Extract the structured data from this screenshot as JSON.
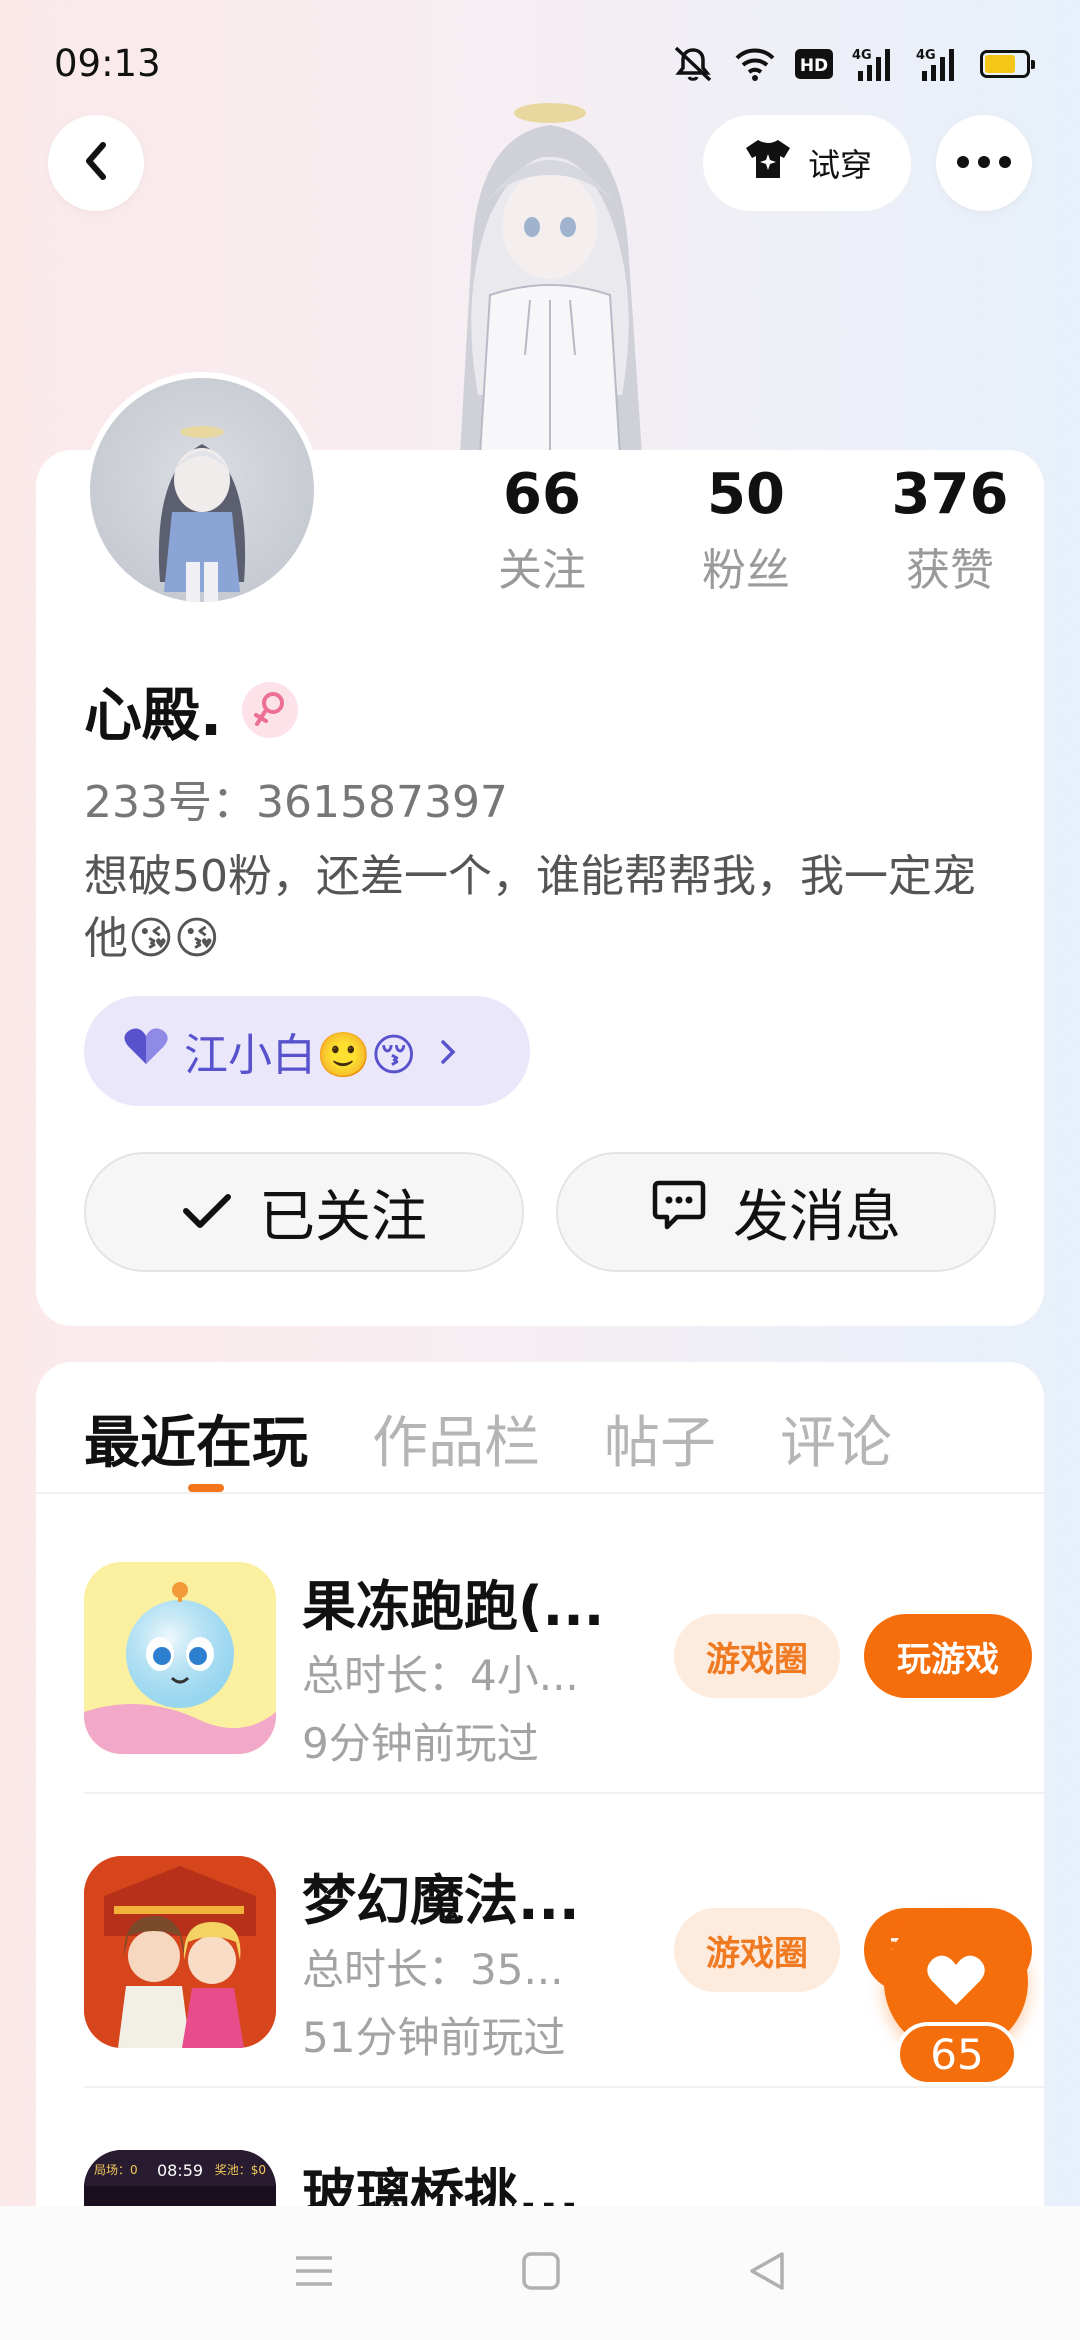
{
  "status_bar": {
    "time": "09:13",
    "network_labels": [
      "4G",
      "4G"
    ],
    "hd_label": "HD",
    "battery_percent": 0.75,
    "battery_color": "#f5c518"
  },
  "header": {
    "back_icon": "chevron-left-icon",
    "tryon_label": "试穿",
    "tryon_icon": "shirt-sparkle-icon",
    "more_icon": "ellipsis-icon"
  },
  "profile": {
    "stats": [
      {
        "value": "66",
        "label": "关注"
      },
      {
        "value": "50",
        "label": "粉丝"
      },
      {
        "value": "376",
        "label": "获赞"
      }
    ],
    "name": "心殿.",
    "gender_icon": "female-icon",
    "uid": "233号：361587397",
    "bio": "想破50粉，还差一个，谁能帮帮我，我一定宠他😘😘",
    "tag_label": "江小白🙂😚",
    "tag_icon": "heart-icon",
    "follow_label": "已关注",
    "message_label": "发消息"
  },
  "tabs": [
    "最近在玩",
    "作品栏",
    "帖子",
    "评论"
  ],
  "games": [
    {
      "title": "果冻跑跑(...",
      "duration": "总时长：4小...",
      "last_played": "9分钟前玩过",
      "circle_label": "游戏圈",
      "play_label": "玩游戏"
    },
    {
      "title": "梦幻魔法...",
      "duration": "总时长：35...",
      "last_played": "51分钟前玩过",
      "circle_label": "游戏圈",
      "play_label": "玩"
    },
    {
      "title": "玻璃桥挑...",
      "icon_left_text": "局场：0",
      "icon_timer": "08:59",
      "icon_right_text": "奖池：$0"
    }
  ],
  "like": {
    "count": "65",
    "color": "#f56e0c"
  },
  "colors": {
    "accent": "#f56e0c",
    "tag_text": "#5852cc",
    "tag_bg": "#eae7fb"
  }
}
